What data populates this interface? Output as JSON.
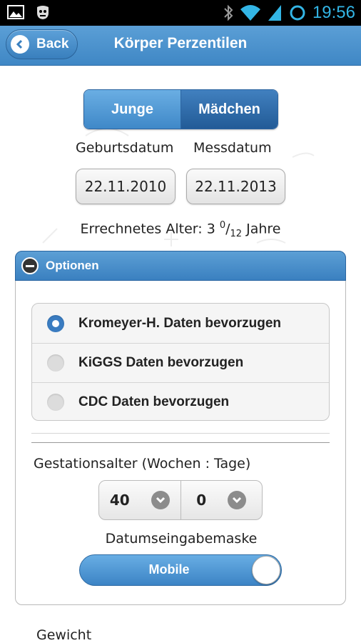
{
  "status_bar": {
    "time": "19:56",
    "icons": [
      "gallery-icon",
      "privacy-mask-icon",
      "bluetooth-icon",
      "wifi-icon",
      "signal-icon",
      "sync-icon"
    ]
  },
  "header": {
    "back_label": "Back",
    "title": "Körper Perzentilen"
  },
  "gender": {
    "options": [
      "Junge",
      "Mädchen"
    ],
    "selected": "Mädchen"
  },
  "dates": {
    "birth_label": "Geburtsdatum",
    "birth_value": "22.11.2010",
    "measure_label": "Messdatum",
    "measure_value": "22.11.2013"
  },
  "age": {
    "label": "Errechnetes Alter:",
    "years": "3",
    "numerator": "0",
    "denominator": "12",
    "unit": "Jahre"
  },
  "options": {
    "title": "Optionen",
    "data_sources": [
      {
        "label": "Kromeyer-H. Daten bevorzugen",
        "selected": true
      },
      {
        "label": "KiGGS Daten bevorzugen",
        "selected": false
      },
      {
        "label": "CDC Daten bevorzugen",
        "selected": false
      }
    ],
    "gestation_label": "Gestationsalter (Wochen : Tage)",
    "gestation_weeks": "40",
    "gestation_days": "0",
    "mask_label": "Datumseingabemaske",
    "mask_value": "Mobile"
  },
  "weight_label": "Gewicht",
  "colors": {
    "accent": "#3f87c5",
    "accent_dark": "#225b97",
    "status_time": "#33b5e5"
  }
}
